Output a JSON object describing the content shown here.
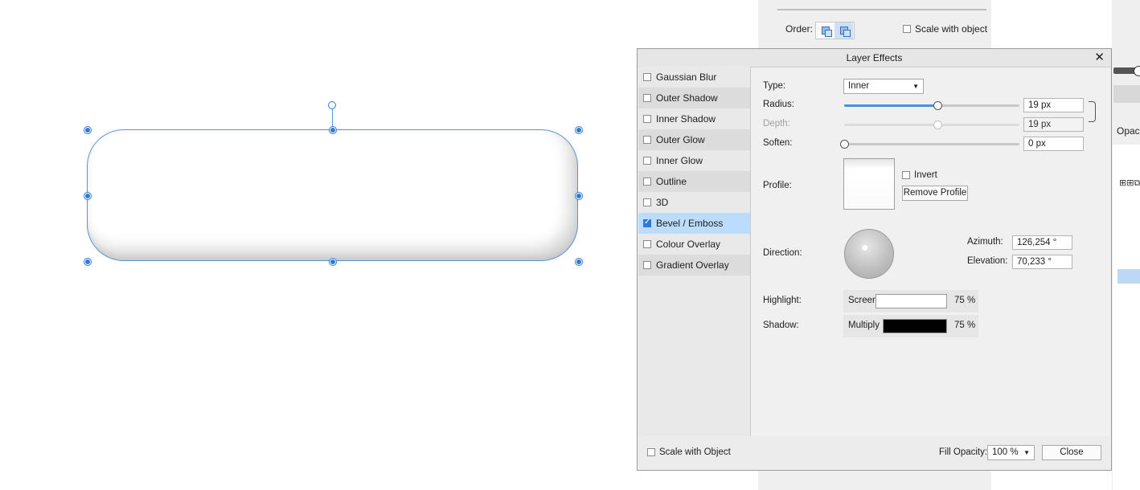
{
  "studio": {
    "order_label": "Order:",
    "scale_with_object": "Scale with object",
    "right_partial_text": "Opaci",
    "right_partial_icons": "⊞⊞⧉"
  },
  "dialog": {
    "title": "Layer Effects",
    "close_glyph": "✕",
    "effects": [
      {
        "label": "Gaussian Blur",
        "checked": false
      },
      {
        "label": "Outer Shadow",
        "checked": false
      },
      {
        "label": "Inner Shadow",
        "checked": false
      },
      {
        "label": "Outer Glow",
        "checked": false
      },
      {
        "label": "Inner Glow",
        "checked": false
      },
      {
        "label": "Outline",
        "checked": false
      },
      {
        "label": "3D",
        "checked": false
      },
      {
        "label": "Bevel / Emboss",
        "checked": true
      },
      {
        "label": "Colour Overlay",
        "checked": false
      },
      {
        "label": "Gradient Overlay",
        "checked": false
      }
    ],
    "type_label": "Type:",
    "type_value": "Inner",
    "radius_label": "Radius:",
    "radius_value": "19 px",
    "radius_slider_fraction": 0.53,
    "depth_label": "Depth:",
    "depth_value": "19 px",
    "depth_slider_fraction": 0.53,
    "soften_label": "Soften:",
    "soften_value": "0 px",
    "soften_slider_fraction": 0.0,
    "profile_label": "Profile:",
    "invert_label": "Invert",
    "remove_profile_label": "Remove Profile",
    "direction_label": "Direction:",
    "azimuth_label": "Azimuth:",
    "azimuth_value": "126,254 °",
    "elevation_label": "Elevation:",
    "elevation_value": "70,233 °",
    "highlight_label": "Highlight:",
    "highlight_mode": "Screen",
    "highlight_color": "#ffffff",
    "highlight_opacity": "75 %",
    "shadow_label": "Shadow:",
    "shadow_mode": "Multiply",
    "shadow_color": "#000000",
    "shadow_opacity": "75 %",
    "footer_scale_label": "Scale with Object",
    "fill_opacity_label": "Fill Opacity:",
    "fill_opacity_value": "100 %",
    "close_button": "Close"
  },
  "colors": {
    "accent": "#2f7ad8",
    "selected_row": "#bcdcfb"
  }
}
